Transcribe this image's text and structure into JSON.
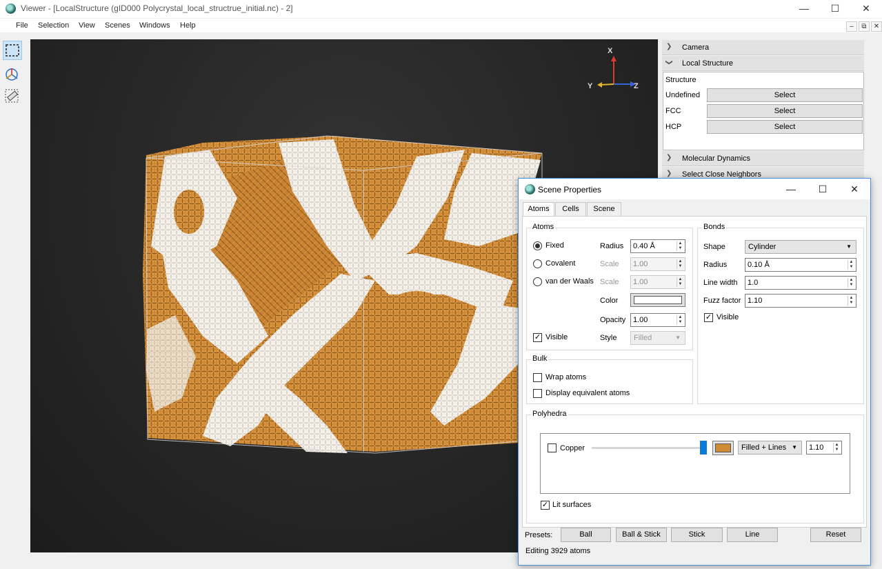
{
  "window": {
    "title": "Viewer - [LocalStructure (gID000 Polycrystal_local_structrue_initial.nc) - 2]",
    "minimize": "—",
    "maximize": "☐",
    "close": "✕"
  },
  "menu": {
    "items": [
      "File",
      "Selection",
      "View",
      "Scenes",
      "Windows",
      "Help"
    ]
  },
  "mdi_controls": {
    "minimize": "–",
    "restore": "⧉",
    "close": "✕"
  },
  "toolbar": {
    "tools": [
      {
        "icon": "selection-rectangle-icon",
        "active": true
      },
      {
        "icon": "rotate-axes-icon",
        "active": false
      },
      {
        "icon": "ruler-select-icon",
        "active": false
      }
    ]
  },
  "viewport": {
    "axes": {
      "x": "X",
      "y": "Y",
      "z": "Z"
    },
    "colors": {
      "atom_orange": "#cf8a35",
      "atom_white": "#f3eee6",
      "background": "#262626"
    }
  },
  "right_panel": {
    "sections": [
      {
        "label": "Camera",
        "expanded": false
      },
      {
        "label": "Local Structure",
        "expanded": true
      },
      {
        "label": "Molecular Dynamics",
        "expanded": false
      },
      {
        "label": "Select Close Neighbors",
        "expanded": false
      }
    ],
    "local_structure": {
      "structure_label": "Structure",
      "rows": [
        {
          "label": "Undefined",
          "button": "Select"
        },
        {
          "label": "FCC",
          "button": "Select"
        },
        {
          "label": "HCP",
          "button": "Select"
        }
      ]
    }
  },
  "dialog": {
    "title": "Scene Properties",
    "tabs": [
      "Atoms",
      "Cells",
      "Scene"
    ],
    "active_tab": "Atoms",
    "atoms": {
      "title": "Atoms",
      "radio_options": [
        "Fixed",
        "Covalent",
        "van der Waals"
      ],
      "selected": "Fixed",
      "radius_label": "Radius",
      "radius_value": "0.40 Å",
      "scale_label": "Scale",
      "scale_value_1": "1.00",
      "scale_value_2": "1.00",
      "color_label": "Color",
      "opacity_label": "Opacity",
      "opacity_value": "1.00",
      "visible_label": "Visible",
      "visible_checked": true,
      "style_label": "Style",
      "style_value": "Filled"
    },
    "bonds": {
      "title": "Bonds",
      "shape_label": "Shape",
      "shape_value": "Cylinder",
      "radius_label": "Radius",
      "radius_value": "0.10 Å",
      "line_width_label": "Line width",
      "line_width_value": "1.0",
      "fuzz_label": "Fuzz factor",
      "fuzz_value": "1.10",
      "visible_label": "Visible",
      "visible_checked": true
    },
    "bulk": {
      "title": "Bulk",
      "wrap_label": "Wrap atoms",
      "display_equiv_label": "Display equivalent atoms"
    },
    "polyhedra": {
      "title": "Polyhedra",
      "element_label": "Copper",
      "element_checked": false,
      "slider_level": 1.0,
      "swatch_color": "#cf8a35",
      "mode_value": "Filled + Lines",
      "value": "1.10",
      "lit_label": "Lit surfaces",
      "lit_checked": true
    },
    "presets": {
      "label": "Presets:",
      "buttons": [
        "Ball",
        "Ball & Stick",
        "Stick",
        "Line"
      ],
      "reset": "Reset"
    },
    "status": "Editing 3929 atoms"
  }
}
